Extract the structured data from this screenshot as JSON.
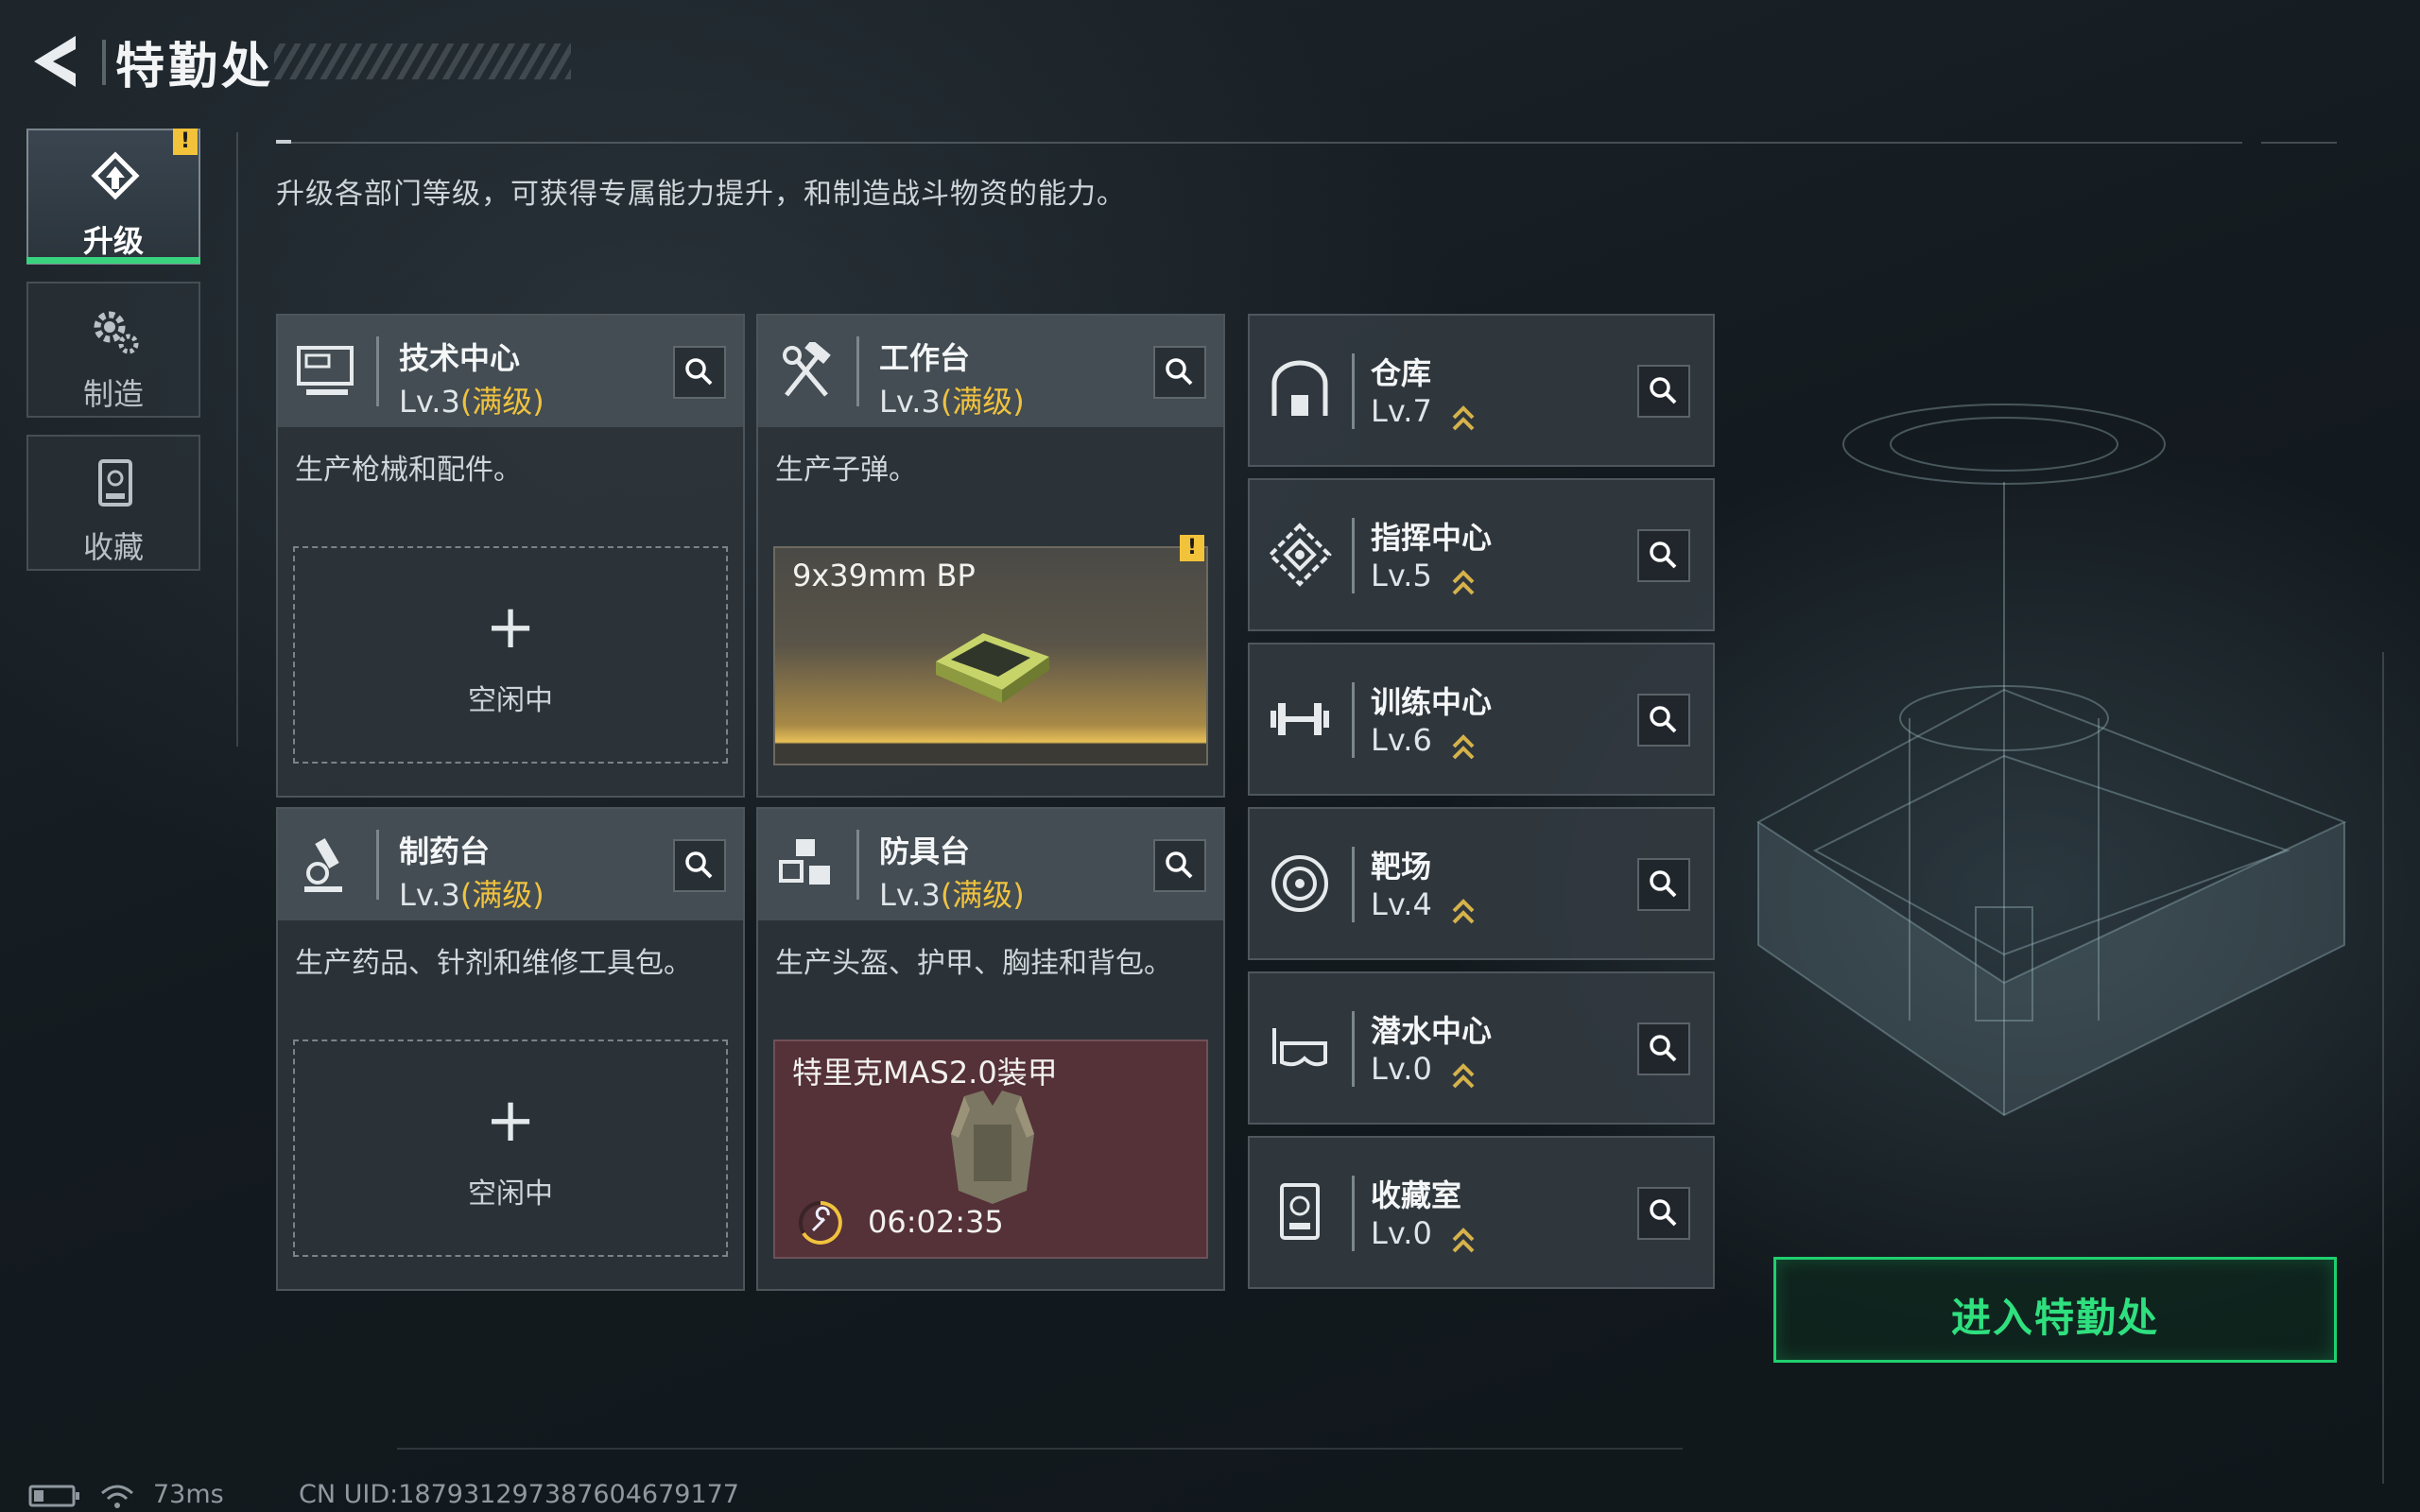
{
  "header": {
    "title": "特勤处",
    "subtitle": "升级各部门等级，可获得专属能力提升，和制造战斗物资的能力。"
  },
  "sidebar": {
    "items": [
      {
        "label": "升级",
        "icon": "upgrade-icon",
        "active": true,
        "alert": "!"
      },
      {
        "label": "制造",
        "icon": "gears-icon",
        "active": false
      },
      {
        "label": "收藏",
        "icon": "collection-icon",
        "active": false
      }
    ]
  },
  "departments": {
    "tech_center": {
      "name": "技术中心",
      "level": "Lv.3",
      "max": "(满级)",
      "desc": "生产枪械和配件。",
      "slot_plus": "+",
      "slot_status": "空闲中"
    },
    "workbench": {
      "name": "工作台",
      "level": "Lv.3",
      "max": "(满级)",
      "desc": "生产子弹。",
      "item": "9x39mm BP",
      "alert": "!"
    },
    "pharmacy": {
      "name": "制药台",
      "level": "Lv.3",
      "max": "(满级)",
      "desc": "生产药品、针剂和维修工具包。",
      "slot_plus": "+",
      "slot_status": "空闲中"
    },
    "armor_bench": {
      "name": "防具台",
      "level": "Lv.3",
      "max": "(满级)",
      "desc": "生产头盔、护甲、胸挂和背包。",
      "item": "特里克MAS2.0装甲",
      "timer": "06:02:35"
    },
    "others": [
      {
        "name": "仓库",
        "level": "Lv.7",
        "icon": "warehouse-icon"
      },
      {
        "name": "指挥中心",
        "level": "Lv.5",
        "icon": "command-center-icon"
      },
      {
        "name": "训练中心",
        "level": "Lv.6",
        "icon": "dumbbell-icon"
      },
      {
        "name": "靶场",
        "level": "Lv.4",
        "icon": "target-icon"
      },
      {
        "name": "潜水中心",
        "level": "Lv.0",
        "icon": "diving-mask-icon"
      },
      {
        "name": "收藏室",
        "level": "Lv.0",
        "icon": "trophy-cabinet-icon"
      }
    ]
  },
  "enter_button": "进入特勤处",
  "status": {
    "ping": "73ms",
    "uid": "CN UID:1879312973876046791​77"
  },
  "colors": {
    "accent_green": "#1fcf6e",
    "max_level_gold": "#f0c23e",
    "alert_yellow": "#f2c23b",
    "armor_slot": "#553138"
  }
}
